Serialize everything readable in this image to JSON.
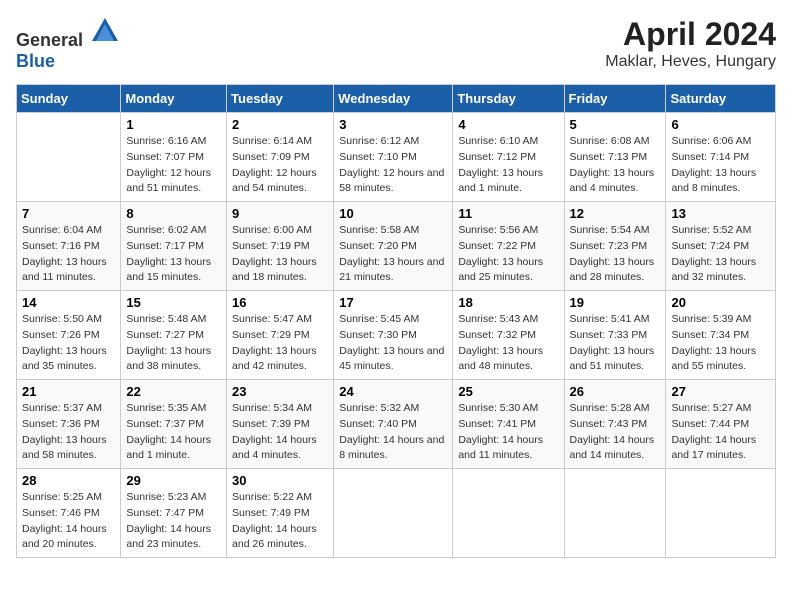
{
  "header": {
    "logo_general": "General",
    "logo_blue": "Blue",
    "title": "April 2024",
    "subtitle": "Maklar, Heves, Hungary"
  },
  "columns": [
    "Sunday",
    "Monday",
    "Tuesday",
    "Wednesday",
    "Thursday",
    "Friday",
    "Saturday"
  ],
  "weeks": [
    [
      {
        "day": "",
        "sunrise": "",
        "sunset": "",
        "daylight": ""
      },
      {
        "day": "1",
        "sunrise": "Sunrise: 6:16 AM",
        "sunset": "Sunset: 7:07 PM",
        "daylight": "Daylight: 12 hours and 51 minutes."
      },
      {
        "day": "2",
        "sunrise": "Sunrise: 6:14 AM",
        "sunset": "Sunset: 7:09 PM",
        "daylight": "Daylight: 12 hours and 54 minutes."
      },
      {
        "day": "3",
        "sunrise": "Sunrise: 6:12 AM",
        "sunset": "Sunset: 7:10 PM",
        "daylight": "Daylight: 12 hours and 58 minutes."
      },
      {
        "day": "4",
        "sunrise": "Sunrise: 6:10 AM",
        "sunset": "Sunset: 7:12 PM",
        "daylight": "Daylight: 13 hours and 1 minute."
      },
      {
        "day": "5",
        "sunrise": "Sunrise: 6:08 AM",
        "sunset": "Sunset: 7:13 PM",
        "daylight": "Daylight: 13 hours and 4 minutes."
      },
      {
        "day": "6",
        "sunrise": "Sunrise: 6:06 AM",
        "sunset": "Sunset: 7:14 PM",
        "daylight": "Daylight: 13 hours and 8 minutes."
      }
    ],
    [
      {
        "day": "7",
        "sunrise": "Sunrise: 6:04 AM",
        "sunset": "Sunset: 7:16 PM",
        "daylight": "Daylight: 13 hours and 11 minutes."
      },
      {
        "day": "8",
        "sunrise": "Sunrise: 6:02 AM",
        "sunset": "Sunset: 7:17 PM",
        "daylight": "Daylight: 13 hours and 15 minutes."
      },
      {
        "day": "9",
        "sunrise": "Sunrise: 6:00 AM",
        "sunset": "Sunset: 7:19 PM",
        "daylight": "Daylight: 13 hours and 18 minutes."
      },
      {
        "day": "10",
        "sunrise": "Sunrise: 5:58 AM",
        "sunset": "Sunset: 7:20 PM",
        "daylight": "Daylight: 13 hours and 21 minutes."
      },
      {
        "day": "11",
        "sunrise": "Sunrise: 5:56 AM",
        "sunset": "Sunset: 7:22 PM",
        "daylight": "Daylight: 13 hours and 25 minutes."
      },
      {
        "day": "12",
        "sunrise": "Sunrise: 5:54 AM",
        "sunset": "Sunset: 7:23 PM",
        "daylight": "Daylight: 13 hours and 28 minutes."
      },
      {
        "day": "13",
        "sunrise": "Sunrise: 5:52 AM",
        "sunset": "Sunset: 7:24 PM",
        "daylight": "Daylight: 13 hours and 32 minutes."
      }
    ],
    [
      {
        "day": "14",
        "sunrise": "Sunrise: 5:50 AM",
        "sunset": "Sunset: 7:26 PM",
        "daylight": "Daylight: 13 hours and 35 minutes."
      },
      {
        "day": "15",
        "sunrise": "Sunrise: 5:48 AM",
        "sunset": "Sunset: 7:27 PM",
        "daylight": "Daylight: 13 hours and 38 minutes."
      },
      {
        "day": "16",
        "sunrise": "Sunrise: 5:47 AM",
        "sunset": "Sunset: 7:29 PM",
        "daylight": "Daylight: 13 hours and 42 minutes."
      },
      {
        "day": "17",
        "sunrise": "Sunrise: 5:45 AM",
        "sunset": "Sunset: 7:30 PM",
        "daylight": "Daylight: 13 hours and 45 minutes."
      },
      {
        "day": "18",
        "sunrise": "Sunrise: 5:43 AM",
        "sunset": "Sunset: 7:32 PM",
        "daylight": "Daylight: 13 hours and 48 minutes."
      },
      {
        "day": "19",
        "sunrise": "Sunrise: 5:41 AM",
        "sunset": "Sunset: 7:33 PM",
        "daylight": "Daylight: 13 hours and 51 minutes."
      },
      {
        "day": "20",
        "sunrise": "Sunrise: 5:39 AM",
        "sunset": "Sunset: 7:34 PM",
        "daylight": "Daylight: 13 hours and 55 minutes."
      }
    ],
    [
      {
        "day": "21",
        "sunrise": "Sunrise: 5:37 AM",
        "sunset": "Sunset: 7:36 PM",
        "daylight": "Daylight: 13 hours and 58 minutes."
      },
      {
        "day": "22",
        "sunrise": "Sunrise: 5:35 AM",
        "sunset": "Sunset: 7:37 PM",
        "daylight": "Daylight: 14 hours and 1 minute."
      },
      {
        "day": "23",
        "sunrise": "Sunrise: 5:34 AM",
        "sunset": "Sunset: 7:39 PM",
        "daylight": "Daylight: 14 hours and 4 minutes."
      },
      {
        "day": "24",
        "sunrise": "Sunrise: 5:32 AM",
        "sunset": "Sunset: 7:40 PM",
        "daylight": "Daylight: 14 hours and 8 minutes."
      },
      {
        "day": "25",
        "sunrise": "Sunrise: 5:30 AM",
        "sunset": "Sunset: 7:41 PM",
        "daylight": "Daylight: 14 hours and 11 minutes."
      },
      {
        "day": "26",
        "sunrise": "Sunrise: 5:28 AM",
        "sunset": "Sunset: 7:43 PM",
        "daylight": "Daylight: 14 hours and 14 minutes."
      },
      {
        "day": "27",
        "sunrise": "Sunrise: 5:27 AM",
        "sunset": "Sunset: 7:44 PM",
        "daylight": "Daylight: 14 hours and 17 minutes."
      }
    ],
    [
      {
        "day": "28",
        "sunrise": "Sunrise: 5:25 AM",
        "sunset": "Sunset: 7:46 PM",
        "daylight": "Daylight: 14 hours and 20 minutes."
      },
      {
        "day": "29",
        "sunrise": "Sunrise: 5:23 AM",
        "sunset": "Sunset: 7:47 PM",
        "daylight": "Daylight: 14 hours and 23 minutes."
      },
      {
        "day": "30",
        "sunrise": "Sunrise: 5:22 AM",
        "sunset": "Sunset: 7:49 PM",
        "daylight": "Daylight: 14 hours and 26 minutes."
      },
      {
        "day": "",
        "sunrise": "",
        "sunset": "",
        "daylight": ""
      },
      {
        "day": "",
        "sunrise": "",
        "sunset": "",
        "daylight": ""
      },
      {
        "day": "",
        "sunrise": "",
        "sunset": "",
        "daylight": ""
      },
      {
        "day": "",
        "sunrise": "",
        "sunset": "",
        "daylight": ""
      }
    ]
  ]
}
